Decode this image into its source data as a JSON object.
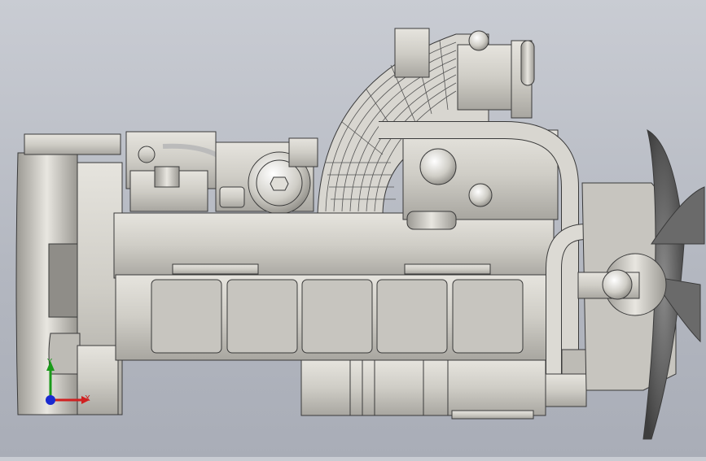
{
  "viewport": {
    "background_top": "#c9ccd3",
    "background_bottom": "#a9adb7",
    "model_color": "#d4d2cc",
    "edge_color": "#3a3a3a"
  },
  "triad": {
    "x_label": "X",
    "y_label": "Y",
    "x_color": "#d02020",
    "y_color": "#1a9a1a",
    "z_color": "#1a2ad0"
  }
}
